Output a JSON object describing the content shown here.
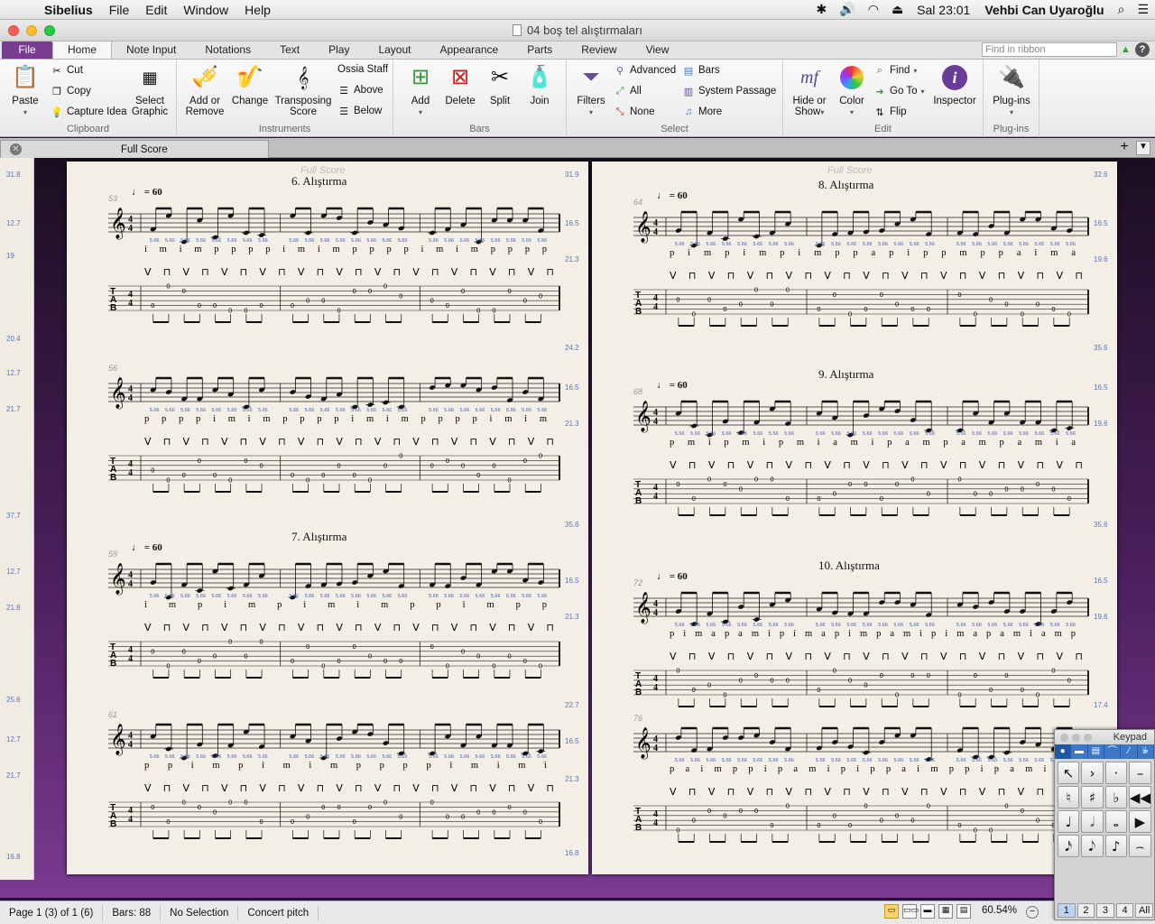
{
  "menubar": {
    "app_name": "Sibelius",
    "items": [
      "File",
      "Edit",
      "Window",
      "Help"
    ],
    "clock": "Sal 23:01",
    "user": "Vehbi Can Uyaroğlu"
  },
  "window": {
    "title": "04 boş tel alıştırmaları"
  },
  "ribbon_tabs": {
    "file": "File",
    "items": [
      "Home",
      "Note Input",
      "Notations",
      "Text",
      "Play",
      "Layout",
      "Appearance",
      "Parts",
      "Review",
      "View"
    ],
    "active": "Home",
    "search_placeholder": "Find in ribbon"
  },
  "ribbon": {
    "clipboard": {
      "name": "Clipboard",
      "paste": "Paste",
      "cut": "Cut",
      "copy": "Copy",
      "capture_idea": "Capture Idea",
      "select_graphic_1": "Select",
      "select_graphic_2": "Graphic"
    },
    "instruments": {
      "name": "Instruments",
      "add_remove_1": "Add or",
      "add_remove_2": "Remove",
      "change": "Change",
      "transposing_1": "Transposing",
      "transposing_2": "Score",
      "ossia": "Ossia Staff",
      "above": "Above",
      "below": "Below"
    },
    "bars": {
      "name": "Bars",
      "add": "Add",
      "delete": "Delete",
      "split": "Split",
      "join": "Join"
    },
    "select": {
      "name": "Select",
      "filters": "Filters",
      "advanced": "Advanced",
      "all": "All",
      "none": "None",
      "bars": "Bars",
      "system_passage": "System Passage",
      "more": "More"
    },
    "edit": {
      "name": "Edit",
      "hide_show_1": "Hide or",
      "hide_show_2": "Show",
      "color": "Color",
      "find": "Find",
      "go_to": "Go To",
      "flip": "Flip",
      "inspector": "Inspector"
    },
    "plugins": {
      "name": "Plug-ins",
      "plugins": "Plug-ins"
    }
  },
  "doc_tab": {
    "label": "Full Score"
  },
  "score": {
    "left_page": {
      "exercises": [
        {
          "title": "6. Alıştırma",
          "tempo": "= 60",
          "bar": "53"
        },
        {
          "title": "",
          "tempo": "",
          "bar": "56"
        },
        {
          "title": "7. Alıştırma",
          "tempo": "= 60",
          "bar": "59"
        },
        {
          "title": "",
          "tempo": "",
          "bar": "61"
        }
      ],
      "header_ghost": "Full Score"
    },
    "right_page": {
      "exercises": [
        {
          "title": "8. Alıştırma",
          "tempo": "= 60",
          "bar": "64"
        },
        {
          "title": "9. Alıştırma",
          "tempo": "= 60",
          "bar": "68"
        },
        {
          "title": "10. Alıştırma",
          "tempo": "= 60",
          "bar": "72"
        },
        {
          "title": "",
          "tempo": "",
          "bar": "76"
        }
      ],
      "header_ghost": "Full Score"
    },
    "fingerings": {
      "l1": "i m i m p p p p i m i m p p p p i m i m p p p p",
      "l2": "p p p p i m i m p p p p i m i m p p p p i m i m",
      "l3": "i m p i m p i m i m p p i m p p",
      "l4": "p p i m p i m i m p p p p i m i m i",
      "r1": "p i m p i m p i m p p a p i p p m p p a i m a",
      "r2": "p m i p m i p m i a m i p a m p a m p a m i a",
      "r3": "p i m a p a m i p i m a p i m p a m i p i m a p a m i a m p",
      "r4": "p a i m p p i p a m i p i p p a i m p p i p a m i p i"
    },
    "bowings": "V ⊓ V ⊓ V ⊓ V ⊓ V ⊓ V ⊓ V ⊓ V ⊓ V ⊓ V ⊓ V ⊓",
    "margin_numbers_left": [
      "31.8",
      "12.7",
      "19",
      "20.4",
      "12.7",
      "21.7",
      "37.7",
      "12.7",
      "21.8",
      "25.6",
      "12.7",
      "21.7",
      "16.8"
    ],
    "margin_numbers_page_left": [
      "31.9",
      "16.5",
      "21.3",
      "24.2",
      "16.5",
      "21.3",
      "35.6",
      "16.5",
      "21.3",
      "22.7",
      "16.5",
      "21.3",
      "16.8"
    ],
    "margin_numbers_page_right": [
      "32.6",
      "16.5",
      "19.6",
      "35.6",
      "16.5",
      "19.6",
      "35.6",
      "16.5",
      "19.6",
      "17.4",
      "16.3",
      "19.6",
      "16.8"
    ],
    "small_offset_labels": [
      "6.06",
      "7.69",
      "6.06",
      "6.63",
      "6.25"
    ]
  },
  "status": {
    "page": "Page 1 (3) of 1 (6)",
    "bars": "Bars: 88",
    "selection": "No Selection",
    "pitch": "Concert pitch",
    "zoom": "60.54%"
  },
  "keypad": {
    "title": "Keypad",
    "tabs": [
      "●",
      "▬",
      "▤",
      "⌒",
      "∕",
      "𝄫"
    ],
    "keys": [
      "↖",
      "›",
      "·",
      "–",
      "♮",
      "♯",
      "♭",
      "◀◀",
      "♩",
      "𝅗𝅥",
      "𝅝",
      "▶",
      "𝅘𝅥𝅯",
      "𝅘𝅥𝅮",
      "♪",
      "⌢",
      "𝄽",
      "𝄾",
      "•",
      " "
    ],
    "layouts": [
      "1",
      "2",
      "3",
      "4",
      "All"
    ]
  },
  "colors": {
    "file_tab": "#7a3c91",
    "accent_blue": "#3d78c8",
    "paper": "#f3efe6"
  }
}
